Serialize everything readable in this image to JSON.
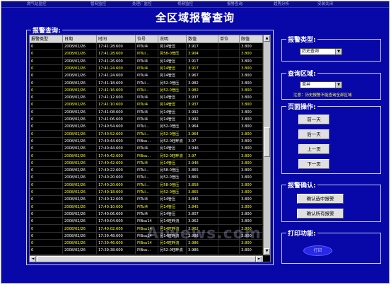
{
  "nav": [
    "燃气站监控",
    "管网监控",
    "处理厂监控",
    "视频监控",
    "报警查询",
    "趋势分析",
    "安装关闭"
  ],
  "title": "全区域报警查询",
  "list_panel": {
    "title": "报警查询:"
  },
  "table": {
    "headers": [
      "报警类型",
      "日期",
      "时间",
      "位号",
      "说明",
      "数值",
      "单位",
      "限值"
    ],
    "rows": [
      {
        "type": "0",
        "date": "2008/02/26",
        "time": "17:41:28.600",
        "tag": "PITul4",
        "desc": "另14管压",
        "value": "3.917",
        "unit": "",
        "limit": "3.800",
        "color": "white"
      },
      {
        "type": "0",
        "date": "2008/02/26",
        "time": "17:41:28.600",
        "tag": "PITul...",
        "desc": "另58-0管压",
        "value": "3.904",
        "unit": "",
        "limit": "3.800",
        "color": "yellow"
      },
      {
        "type": "0",
        "date": "2008/02/26",
        "time": "17:41:26.600",
        "tag": "PITul4",
        "desc": "另14管压",
        "value": "3.917",
        "unit": "",
        "limit": "3.800",
        "color": "white"
      },
      {
        "type": "0",
        "date": "2008/02/26",
        "time": "17:41:24.600",
        "tag": "PITul4",
        "desc": "另14管压",
        "value": "3.917",
        "unit": "",
        "limit": "3.800",
        "color": "yellow"
      },
      {
        "type": "0",
        "date": "2008/02/26",
        "time": "17:41:24.600",
        "tag": "PITul4",
        "desc": "另14管压",
        "value": "3.967",
        "unit": "",
        "limit": "3.800",
        "color": "white"
      },
      {
        "type": "0",
        "date": "2008/02/26",
        "time": "17:41:18.600",
        "tag": "PITul...",
        "desc": "另52-0管压",
        "value": "3.982",
        "unit": "",
        "limit": "3.800",
        "color": "white"
      },
      {
        "type": "0",
        "date": "2008/02/26",
        "time": "17:41:16.600",
        "tag": "PITul...",
        "desc": "另52-0管压",
        "value": "3.982",
        "unit": "",
        "limit": "3.800",
        "color": "yellow"
      },
      {
        "type": "0",
        "date": "2008/02/26",
        "time": "17:41:12.600",
        "tag": "PITul4",
        "desc": "另14管压",
        "value": "3.937",
        "unit": "",
        "limit": "3.800",
        "color": "white"
      },
      {
        "type": "0",
        "date": "2008/02/26",
        "time": "17:41:10.600",
        "tag": "PITul4",
        "desc": "另14管压",
        "value": "3.937",
        "unit": "",
        "limit": "3.800",
        "color": "yellow"
      },
      {
        "type": "0",
        "date": "2008/02/26",
        "time": "17:41:08.600",
        "tag": "PITul4",
        "desc": "另14管压",
        "value": "3.992",
        "unit": "",
        "limit": "3.800",
        "color": "white"
      },
      {
        "type": "0",
        "date": "2008/02/26",
        "time": "17:41:06.600",
        "tag": "PITul4",
        "desc": "另14管压",
        "value": "3.992",
        "unit": "",
        "limit": "3.800",
        "color": "white"
      },
      {
        "type": "0",
        "date": "2008/02/26",
        "time": "17:40:54.600",
        "tag": "PITul...",
        "desc": "另52-0管压",
        "value": "3.964",
        "unit": "",
        "limit": "3.800",
        "color": "white"
      },
      {
        "type": "0",
        "date": "2008/02/26",
        "time": "17:40:52.600",
        "tag": "PITul...",
        "desc": "另52-0管压",
        "value": "3.964",
        "unit": "",
        "limit": "3.800",
        "color": "yellow"
      },
      {
        "type": "0",
        "date": "2008/02/26",
        "time": "17:40:44.600",
        "tag": "PIBsu...",
        "desc": "另52-0旺畔流",
        "value": "3.97",
        "unit": "",
        "limit": "3.800",
        "color": "white"
      },
      {
        "type": "0",
        "date": "2008/02/26",
        "time": "17:40:44.600",
        "tag": "PITul4",
        "desc": "另14管压",
        "value": "3.946",
        "unit": "",
        "limit": "3.800",
        "color": "white"
      },
      {
        "type": "0",
        "date": "2008/02/26",
        "time": "17:40:42.600",
        "tag": "PIBsu...",
        "desc": "另52-0旺畔流",
        "value": "3.97",
        "unit": "",
        "limit": "3.800",
        "color": "yellow"
      },
      {
        "type": "0",
        "date": "2008/02/26",
        "time": "17:40:42.600",
        "tag": "PITul4",
        "desc": "另14管压",
        "value": "3.946",
        "unit": "",
        "limit": "3.800",
        "color": "yellow"
      },
      {
        "type": "0",
        "date": "2008/02/26",
        "time": "17:40:22.600",
        "tag": "PITul...",
        "desc": "另58-0管压",
        "value": "3.865",
        "unit": "",
        "limit": "3.800",
        "color": "white"
      },
      {
        "type": "0",
        "date": "2008/02/26",
        "time": "17:40:20.600",
        "tag": "PITul...",
        "desc": "另52-0管压",
        "value": "3.865",
        "unit": "",
        "limit": "3.800",
        "color": "white"
      },
      {
        "type": "0",
        "date": "2008/02/26",
        "time": "17:40:20.600",
        "tag": "PITul...",
        "desc": "另58-0管压",
        "value": "3.858",
        "unit": "",
        "limit": "3.800",
        "color": "yellow"
      },
      {
        "type": "0",
        "date": "2008/02/26",
        "time": "17:40:18.600",
        "tag": "PITul...",
        "desc": "另52-0管压",
        "value": "3.865",
        "unit": "",
        "limit": "3.800",
        "color": "yellow"
      },
      {
        "type": "0",
        "date": "2008/02/26",
        "time": "17:40:12.600",
        "tag": "PITul4",
        "desc": "另14管压",
        "value": "3.845",
        "unit": "",
        "limit": "3.800",
        "color": "white"
      },
      {
        "type": "0",
        "date": "2008/02/26",
        "time": "17:40:10.600",
        "tag": "PITul4",
        "desc": "另14管压",
        "value": "3.845",
        "unit": "",
        "limit": "3.800",
        "color": "yellow"
      },
      {
        "type": "0",
        "date": "2008/02/26",
        "time": "17:40:06.600",
        "tag": "PITul4",
        "desc": "另14管压",
        "value": "3.807",
        "unit": "",
        "limit": "3.800",
        "color": "white"
      },
      {
        "type": "0",
        "date": "2008/02/26",
        "time": "17:40:04.600",
        "tag": "PIBsu14",
        "desc": "另14旺畔流",
        "value": "3.962",
        "unit": "",
        "limit": "3.800",
        "color": "white"
      },
      {
        "type": "0",
        "date": "2008/02/26",
        "time": "17:40:02.600",
        "tag": "PIBsu14",
        "desc": "另14旺畔流",
        "value": "3.962",
        "unit": "",
        "limit": "3.800",
        "color": "yellow"
      },
      {
        "type": "0",
        "date": "2008/02/26",
        "time": "17:39:48.600",
        "tag": "PIBsu14",
        "desc": "另14旺畔流",
        "value": "3.986",
        "unit": "",
        "limit": "3.800",
        "color": "white"
      },
      {
        "type": "0",
        "date": "2008/02/26",
        "time": "17:39:46.600",
        "tag": "PIBsu14",
        "desc": "另14旺畔流",
        "value": "3.986",
        "unit": "",
        "limit": "3.800",
        "color": "yellow"
      },
      {
        "type": "0",
        "date": "2008/02/26",
        "time": "17:39:38.600",
        "tag": "PIBsu...",
        "desc": "另52-0旺畔流",
        "value": "3.986",
        "unit": "",
        "limit": "3.800",
        "color": "white"
      }
    ]
  },
  "alarm_type": {
    "title": "报警类型:",
    "selected": "历史查询"
  },
  "query_area": {
    "title": "查询区域:",
    "selected": "单井",
    "note": "注意：历史报警不能查询全部区域"
  },
  "page_ops": {
    "title": "页面操作:",
    "buttons": [
      "前一天",
      "后一天",
      "上一页",
      "下一页"
    ]
  },
  "alarm_confirm": {
    "title": "报警确认:",
    "buttons": [
      "确认选中报警",
      "确认所有报警"
    ]
  },
  "print": {
    "title": "打印功能:",
    "button": "打印"
  },
  "watermark": "Aiwews.com",
  "colors": {
    "background": "#0808a8",
    "alarm_yellow": "#ffff30",
    "alarm_white": "#ffffff"
  }
}
